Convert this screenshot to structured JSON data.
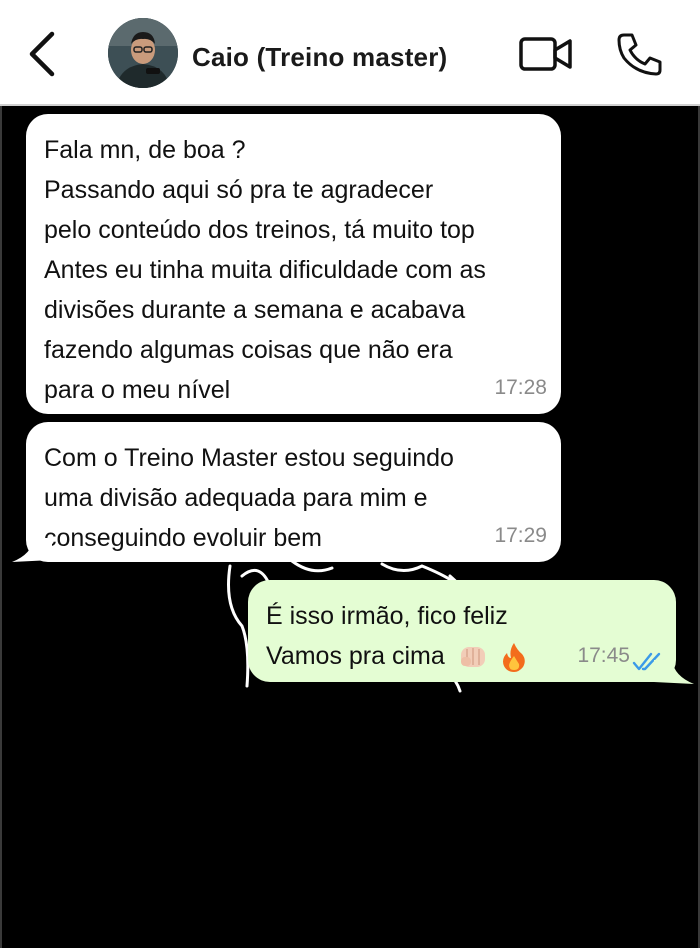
{
  "header": {
    "contact_name": "Caio (Treino master)",
    "back_icon": "chevron-left-icon",
    "video_icon": "video-camera-icon",
    "call_icon": "phone-icon"
  },
  "messages": [
    {
      "direction": "incoming",
      "lines": [
        "Fala mn, de boa ?",
        "Passando aqui só pra te agradecer",
        "pelo conteúdo dos treinos, tá muito top",
        "Antes eu tinha muita dificuldade com as",
        "divisões durante a semana e acabava",
        "fazendo algumas coisas que não era",
        "para o meu nível"
      ],
      "time": "17:28"
    },
    {
      "direction": "incoming",
      "lines": [
        "Com o Treino Master estou seguindo",
        "uma divisão adequada para mim e",
        "conseguindo evoluir bem"
      ],
      "time": "17:29"
    },
    {
      "direction": "outgoing",
      "lines": [
        "É isso irmão, fico feliz",
        "Vamos pra cima"
      ],
      "emojis": [
        "fist-bump-emoji",
        "fire-emoji"
      ],
      "time": "17:45",
      "status": "read-double-check-icon"
    }
  ],
  "colors": {
    "header_bg": "#ffffff",
    "chat_bg": "#000000",
    "incoming_bubble": "#ffffff",
    "outgoing_bubble": "#e4fdd3",
    "read_check": "#3b9ae8",
    "timestamp": "#8a8a8a"
  }
}
